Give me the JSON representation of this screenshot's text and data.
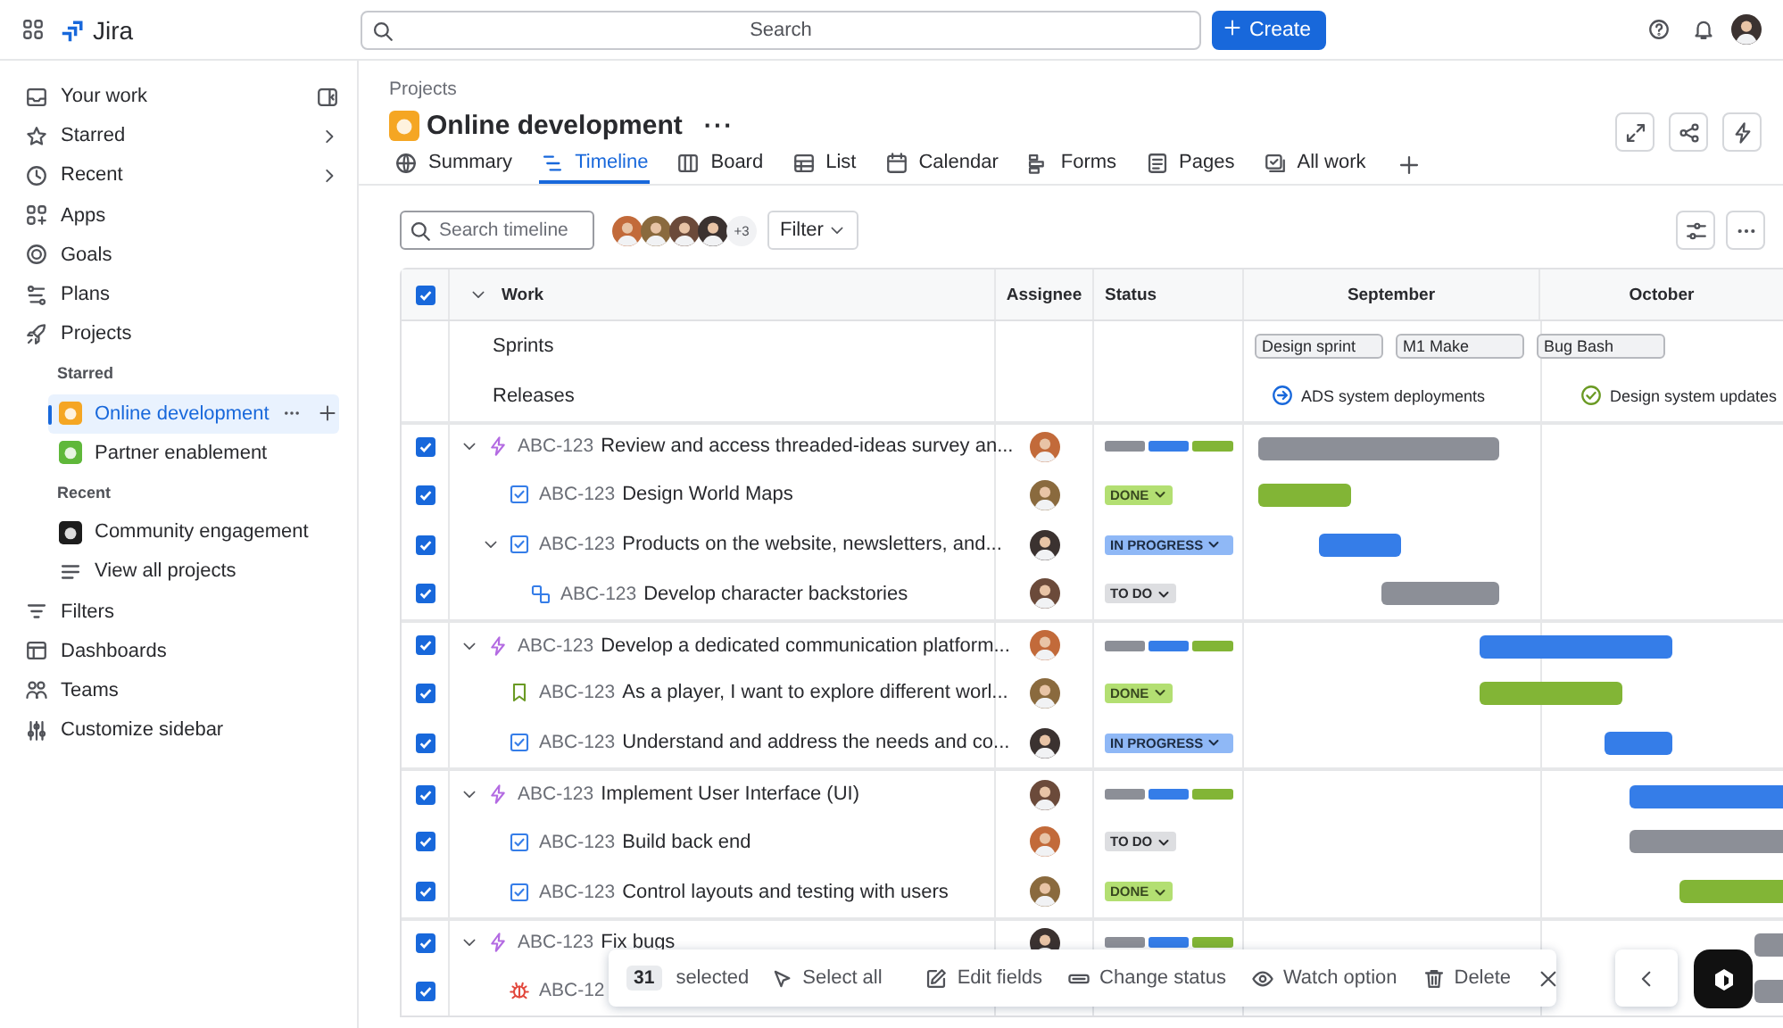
{
  "top_bar": {
    "product": "Jira",
    "search": {
      "placeholder": "Search"
    },
    "create_button": "Create"
  },
  "sidebar": {
    "items": [
      {
        "label": "Your work",
        "kind": "nav",
        "selected": false,
        "expandable": false
      },
      {
        "label": "Starred",
        "kind": "nav",
        "selected": false,
        "expandable": true
      },
      {
        "label": "Recent",
        "kind": "nav",
        "selected": false,
        "expandable": true
      },
      {
        "label": "Apps",
        "kind": "nav",
        "selected": false,
        "expandable": false
      },
      {
        "label": "Goals",
        "kind": "nav",
        "selected": false,
        "expandable": false
      },
      {
        "label": "Plans",
        "kind": "nav",
        "selected": false,
        "expandable": false
      },
      {
        "label": "Projects",
        "kind": "nav",
        "selected": false,
        "expandable": false
      },
      {
        "label": "Starred",
        "kind": "heading"
      },
      {
        "label": "Online development",
        "kind": "project",
        "color": "#f5a623",
        "selected": true
      },
      {
        "label": "Partner enablement",
        "kind": "project",
        "color": "#5fb83a",
        "selected": false
      },
      {
        "label": "Recent",
        "kind": "heading"
      },
      {
        "label": "Community engagement",
        "kind": "project",
        "color": "#1d1d1d",
        "selected": false
      },
      {
        "label": "View all projects",
        "kind": "link",
        "selected": false
      },
      {
        "label": "Filters",
        "kind": "nav",
        "selected": false,
        "expandable": false
      },
      {
        "label": "Dashboards",
        "kind": "nav",
        "selected": false,
        "expandable": false
      },
      {
        "label": "Teams",
        "kind": "nav",
        "selected": false,
        "expandable": false
      },
      {
        "label": "Customize sidebar",
        "kind": "nav",
        "selected": false,
        "expandable": false
      }
    ]
  },
  "header": {
    "breadcrumb": "Projects",
    "title": "Online development",
    "more": "···"
  },
  "tabs": [
    {
      "label": "Summary",
      "selected": false
    },
    {
      "label": "Timeline",
      "selected": true
    },
    {
      "label": "Board",
      "selected": false
    },
    {
      "label": "List",
      "selected": false
    },
    {
      "label": "Calendar",
      "selected": false
    },
    {
      "label": "Forms",
      "selected": false
    },
    {
      "label": "Pages",
      "selected": false
    },
    {
      "label": "All work",
      "selected": false
    }
  ],
  "toolbar": {
    "search": {
      "placeholder": "Search timeline"
    },
    "more_assignees": "+3",
    "filter": "Filter"
  },
  "table": {
    "select_all_checked": true,
    "columns": [
      "Work",
      "Assignee",
      "Status"
    ],
    "months": [
      "September",
      "October"
    ],
    "sprints_label": "Sprints",
    "sprints": [
      "Design sprint",
      "M1 Make",
      "Bug Bash"
    ],
    "releases_label": "Releases",
    "releases": [
      {
        "name": "ADS system deployments",
        "kind": "upcoming"
      },
      {
        "name": "Design system updates",
        "kind": "released"
      }
    ],
    "rows": [
      {
        "key": "ABC-123",
        "summary": "Review and access threaded-ideas survey an...",
        "kind": "epic",
        "checked": true,
        "expanded": true,
        "status": {
          "kind": "progress"
        },
        "color": "#8c8f97",
        "children": [
          {
            "key": "ABC-123",
            "summary": "Design World Maps",
            "kind": "task",
            "checked": true,
            "status": {
              "kind": "done",
              "label": "DONE"
            },
            "color": "#82b536"
          },
          {
            "key": "ABC-123",
            "summary": "Products on the website, newsletters, and...",
            "kind": "task",
            "checked": true,
            "expanded": true,
            "status": {
              "kind": "in_progress",
              "label": "IN PROGRESS"
            },
            "color": "#357de8",
            "children": [
              {
                "key": "ABC-123",
                "summary": "Develop character backstories",
                "kind": "subtask",
                "checked": true,
                "status": {
                  "kind": "todo",
                  "label": "TO DO"
                },
                "color": "#8c8f97"
              }
            ]
          }
        ]
      },
      {
        "key": "ABC-123",
        "summary": "Develop a dedicated communication platform...",
        "kind": "epic",
        "checked": true,
        "expanded": true,
        "status": {
          "kind": "progress"
        },
        "color": "#357de8",
        "children": [
          {
            "key": "ABC-123",
            "summary": "As a player, I want to explore different worl...",
            "kind": "story",
            "checked": true,
            "status": {
              "kind": "done",
              "label": "DONE"
            },
            "color": "#82b536"
          },
          {
            "key": "ABC-123",
            "summary": "Understand and address the needs and co...",
            "kind": "task",
            "checked": true,
            "status": {
              "kind": "in_progress",
              "label": "IN PROGRESS"
            },
            "color": "#357de8"
          }
        ]
      },
      {
        "key": "ABC-123",
        "summary": "Implement User Interface (UI)",
        "kind": "epic",
        "checked": true,
        "expanded": true,
        "status": {
          "kind": "progress"
        },
        "color": "#357de8",
        "children": [
          {
            "key": "ABC-123",
            "summary": "Build back end",
            "kind": "task",
            "checked": true,
            "status": {
              "kind": "todo",
              "label": "TO DO"
            },
            "color": "#8c8f97"
          },
          {
            "key": "ABC-123",
            "summary": "Control layouts and testing with users",
            "kind": "task",
            "checked": true,
            "status": {
              "kind": "done",
              "label": "DONE"
            },
            "color": "#82b536"
          }
        ]
      },
      {
        "key": "ABC-123",
        "summary": "Fix bugs",
        "kind": "epic",
        "checked": true,
        "expanded": true,
        "status": {
          "kind": "progress"
        },
        "color": "#8c8f97",
        "children": [
          {
            "key": "ABC-12",
            "kind": "bug",
            "checked": true,
            "color": "#8c8f97"
          }
        ]
      }
    ]
  },
  "action_bar": {
    "count": "31",
    "count_label": "selected",
    "actions": [
      "Select all",
      "Edit fields",
      "Change status",
      "Watch option",
      "Delete"
    ]
  }
}
